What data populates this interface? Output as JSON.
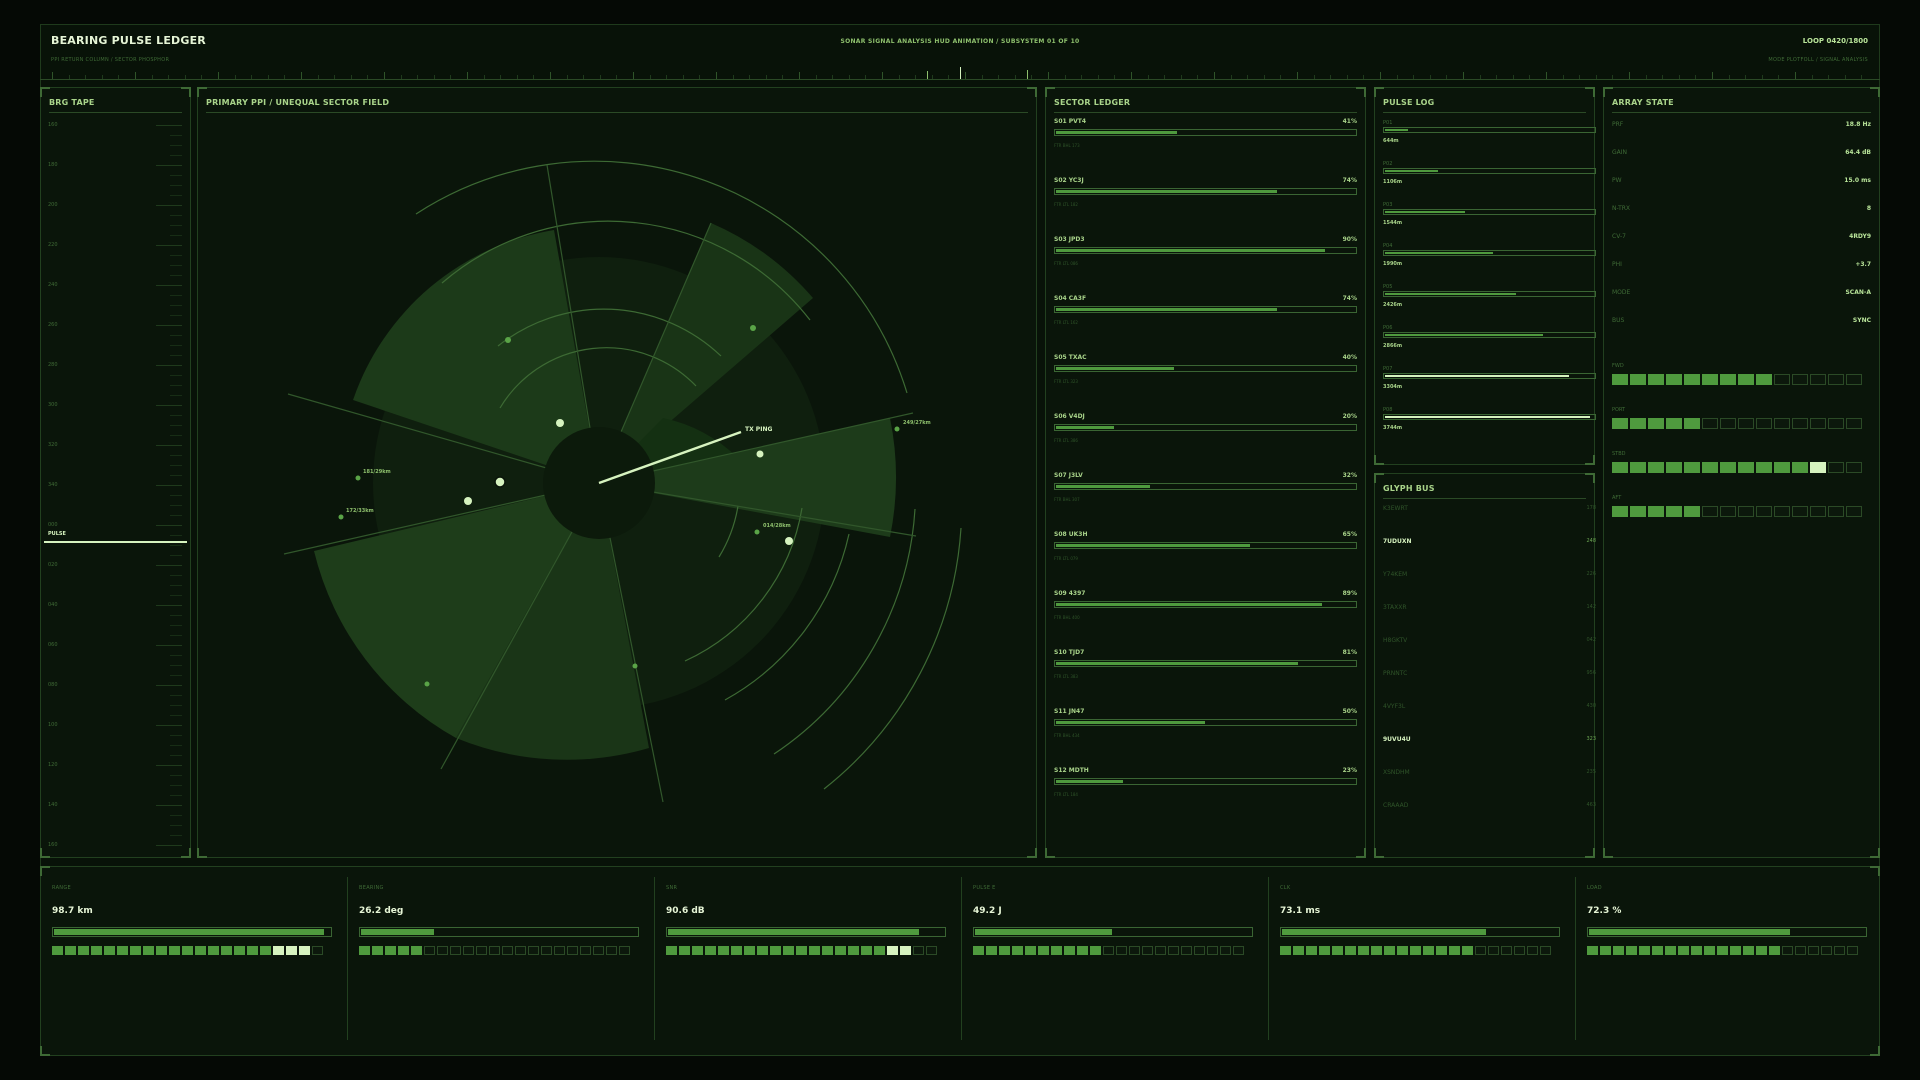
{
  "header": {
    "title": "BEARING PULSE LEDGER",
    "subtitle": "PPI RETURN COLUMN / SECTOR PHOSPHOR",
    "center": "SONAR SIGNAL ANALYSIS HUD ANIMATION  /  SUBSYSTEM 01 OF 10",
    "loop": "LOOP 0420/1800",
    "mode": "MODE PLOTFOLL / SIGNAL ANALYSIS"
  },
  "colors": {
    "accent": "#4f9a3e",
    "hot": "#d6f3bf",
    "bg": "#081208",
    "border": "#22401f"
  },
  "brg_tape": {
    "title": "BRG TAPE",
    "labels": [
      "160",
      "180",
      "200",
      "220",
      "240",
      "260",
      "280",
      "300",
      "320",
      "340",
      "000",
      "020",
      "040",
      "060",
      "080",
      "100",
      "120",
      "140",
      "160"
    ],
    "pulse_label": "PULSE"
  },
  "ppi": {
    "title": "PRIMARY PPI  /  UNEQUAL SECTOR FIELD",
    "labels": {
      "tx": "TX PING",
      "c1": "249/27km",
      "c2": "181/29km",
      "c3": "172/33km",
      "c4": "014/28km"
    }
  },
  "sector_ledger": {
    "title": "SECTOR LEDGER",
    "rows": [
      {
        "name": "S01  PVT4",
        "pct": "41%",
        "value": 0.41,
        "meta": "FTR BHL 173"
      },
      {
        "name": "S02  YC3J",
        "pct": "74%",
        "value": 0.74,
        "meta": "FTR LTL 182"
      },
      {
        "name": "S03  JPD3",
        "pct": "90%",
        "value": 0.9,
        "meta": "FTR LTL 086"
      },
      {
        "name": "S04  CA3F",
        "pct": "74%",
        "value": 0.74,
        "meta": "FTR LTL 162"
      },
      {
        "name": "S05  TXAC",
        "pct": "40%",
        "value": 0.4,
        "meta": "FTR LTL 323"
      },
      {
        "name": "S06  V4DJ",
        "pct": "20%",
        "value": 0.2,
        "meta": "FTR LTL 386"
      },
      {
        "name": "S07  J3LV",
        "pct": "32%",
        "value": 0.32,
        "meta": "FTR BHL 307"
      },
      {
        "name": "S08  UK3H",
        "pct": "65%",
        "value": 0.65,
        "meta": "FTR LTL 079"
      },
      {
        "name": "S09  4397",
        "pct": "89%",
        "value": 0.89,
        "meta": "FTR BHL 400"
      },
      {
        "name": "S10  TJD7",
        "pct": "81%",
        "value": 0.81,
        "meta": "FTR LTL 383"
      },
      {
        "name": "S11  JN47",
        "pct": "50%",
        "value": 0.5,
        "meta": "FTR BHL 434"
      },
      {
        "name": "S12  MDTH",
        "pct": "23%",
        "value": 0.23,
        "meta": "FTR LTL 184"
      }
    ]
  },
  "pulse_log": {
    "title": "PULSE LOG",
    "rows": [
      {
        "id": "P01",
        "value": 0.12,
        "range": "644m",
        "hot": false
      },
      {
        "id": "P02",
        "value": 0.26,
        "range": "1106m",
        "hot": false
      },
      {
        "id": "P03",
        "value": 0.39,
        "range": "1544m",
        "hot": false
      },
      {
        "id": "P04",
        "value": 0.52,
        "range": "1990m",
        "hot": false
      },
      {
        "id": "P05",
        "value": 0.63,
        "range": "2426m",
        "hot": false
      },
      {
        "id": "P06",
        "value": 0.76,
        "range": "2866m",
        "hot": false
      },
      {
        "id": "P07",
        "value": 0.88,
        "range": "3304m",
        "hot": true
      },
      {
        "id": "P08",
        "value": 0.98,
        "range": "3744m",
        "hot": true
      }
    ]
  },
  "glyph_bus": {
    "title": "GLYPH BUS",
    "rows": [
      {
        "code": "K3EWRT",
        "num": "178",
        "on": false
      },
      {
        "code": "7UDUXN",
        "num": "248",
        "on": true
      },
      {
        "code": "Y74KEM",
        "num": "226",
        "on": false
      },
      {
        "code": "3TAXXR",
        "num": "142",
        "on": false
      },
      {
        "code": "H8GKTV",
        "num": "042",
        "on": false
      },
      {
        "code": "PRNNTC",
        "num": "956",
        "on": false
      },
      {
        "code": "4VYF3L",
        "num": "430",
        "on": false
      },
      {
        "code": "9UVU4U",
        "num": "323",
        "on": true
      },
      {
        "code": "XSNDHM",
        "num": "235",
        "on": false
      },
      {
        "code": "CRAAAD",
        "num": "463",
        "on": false
      }
    ]
  },
  "array_state": {
    "title": "ARRAY STATE",
    "rows": [
      {
        "k": "PRF",
        "v": "18.8 Hz"
      },
      {
        "k": "GAIN",
        "v": "64.4 dB"
      },
      {
        "k": "PW",
        "v": "15.0 ms"
      },
      {
        "k": "N-TRX",
        "v": "8"
      },
      {
        "k": "CV-7",
        "v": "4RDY9"
      },
      {
        "k": "PHI",
        "v": "+3.7"
      },
      {
        "k": "MODE",
        "v": "SCAN-A"
      },
      {
        "k": "BUS",
        "v": "SYNC"
      }
    ],
    "segments": [
      {
        "label": "FWD",
        "on": 9,
        "hot": 0,
        "total": 14
      },
      {
        "label": "PORT",
        "on": 5,
        "hot": 0,
        "total": 14
      },
      {
        "label": "STBD",
        "on": 11,
        "hot": 1,
        "total": 14
      },
      {
        "label": "AFT",
        "on": 5,
        "hot": 0,
        "total": 14
      }
    ]
  },
  "metrics": [
    {
      "label": "RANGE",
      "value": "98.7 km",
      "fill": 0.98,
      "on": 17,
      "hot": 3
    },
    {
      "label": "BEARING",
      "value": "26.2 deg",
      "fill": 0.27,
      "on": 5,
      "hot": 0
    },
    {
      "label": "SNR",
      "value": "90.6 dB",
      "fill": 0.91,
      "on": 17,
      "hot": 2
    },
    {
      "label": "PULSE E",
      "value": "49.2 J",
      "fill": 0.5,
      "on": 10,
      "hot": 0
    },
    {
      "label": "CLK",
      "value": "73.1 ms",
      "fill": 0.74,
      "on": 15,
      "hot": 0
    },
    {
      "label": "LOAD",
      "value": "72.3 %",
      "fill": 0.73,
      "on": 15,
      "hot": 0
    }
  ]
}
